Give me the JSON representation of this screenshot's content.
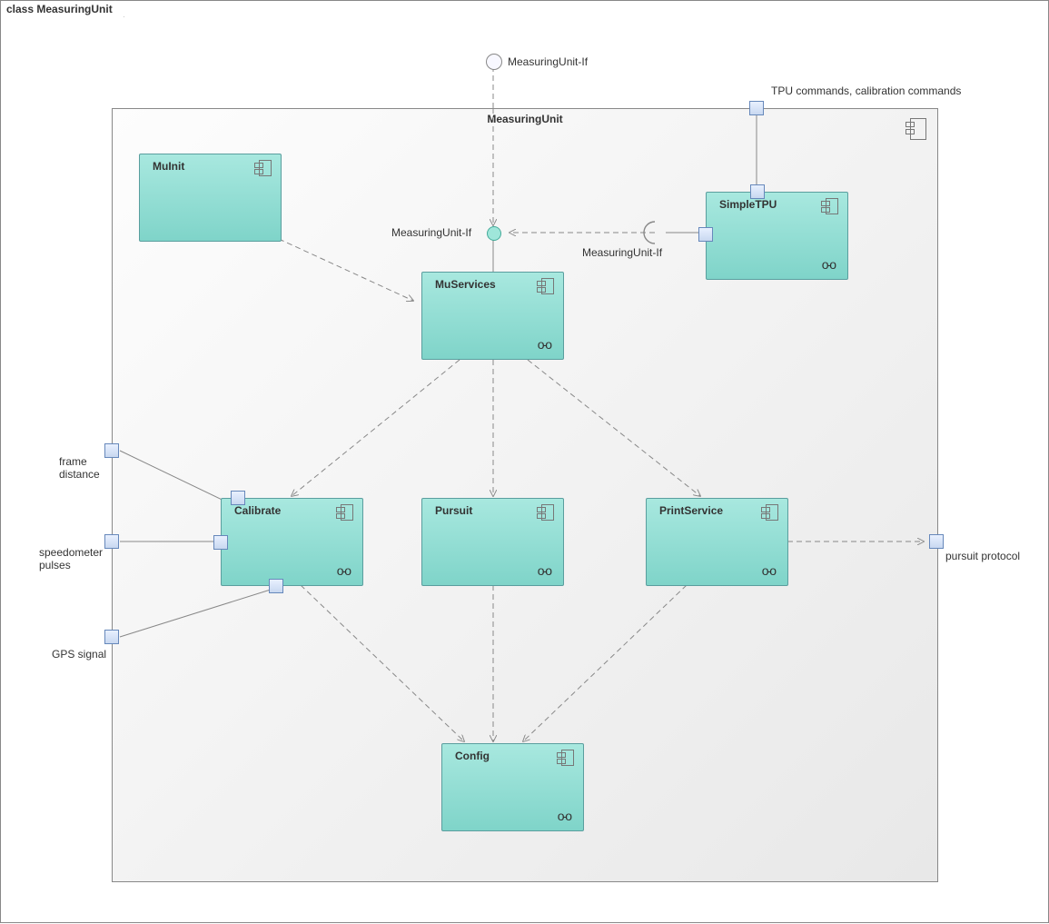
{
  "title": "class MeasuringUnit",
  "frame": {
    "title": "MeasuringUnit"
  },
  "interface": {
    "top": "MeasuringUnit-If",
    "ball": "MeasuringUnit-If",
    "socket": "MeasuringUnit-If"
  },
  "components": {
    "muinit": "MuInit",
    "muservices": "MuServices",
    "simpletpu": "SimpleTPU",
    "calibrate": "Calibrate",
    "pursuit": "Pursuit",
    "printservice": "PrintService",
    "config": "Config"
  },
  "ports": {
    "tpu_commands": "TPU commands, calibration commands",
    "frame_distance": "frame\ndistance",
    "speedometer_pulses": "speedometer\npulses",
    "gps_signal": "GPS signal",
    "pursuit_protocol": "pursuit protocol"
  },
  "glasses": "o-o"
}
